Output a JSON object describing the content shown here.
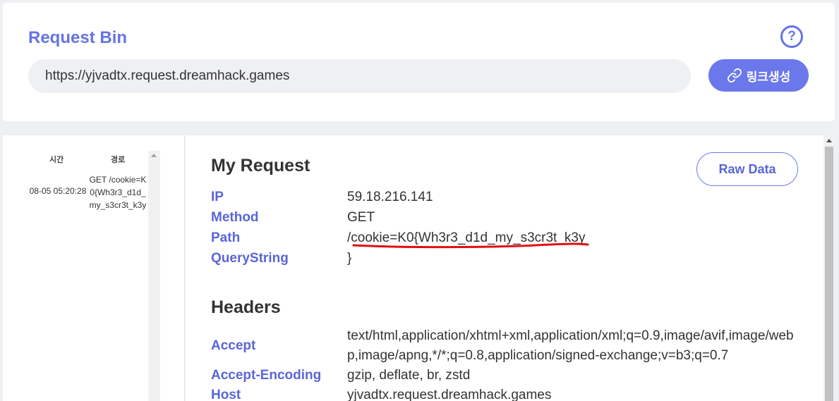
{
  "header": {
    "title": "Request Bin",
    "url": "https://yjvadtx.request.dreamhack.games",
    "generate_label": "링크생성",
    "help_symbol": "?",
    "accent": "#6574e4"
  },
  "sidebar": {
    "col_time": "시간",
    "col_path": "경로",
    "entries": [
      {
        "time": "08-05 05:20:28",
        "path": "GET /cookie=K0{Wh3r3_d1d_my_s3cr3t_k3y"
      }
    ]
  },
  "request": {
    "section_title": "My Request",
    "raw_label": "Raw Data",
    "fields": [
      {
        "key": "IP",
        "value": "59.18.216.141"
      },
      {
        "key": "Method",
        "value": "GET"
      },
      {
        "key": "Path",
        "value": "/cookie=K0{Wh3r3_d1d_my_s3cr3t_k3y"
      },
      {
        "key": "QueryString",
        "value": "}"
      }
    ]
  },
  "headers": {
    "section_title": "Headers",
    "fields": [
      {
        "key": "Accept",
        "value": "text/html,application/xhtml+xml,application/xml;q=0.9,image/avif,image/webp,image/apng,*/*;q=0.8,application/signed-exchange;v=b3;q=0.7"
      },
      {
        "key": "Accept-Encoding",
        "value": "gzip, deflate, br, zstd"
      },
      {
        "key": "Host",
        "value": "yjvadtx.request.dreamhack.games"
      }
    ]
  }
}
